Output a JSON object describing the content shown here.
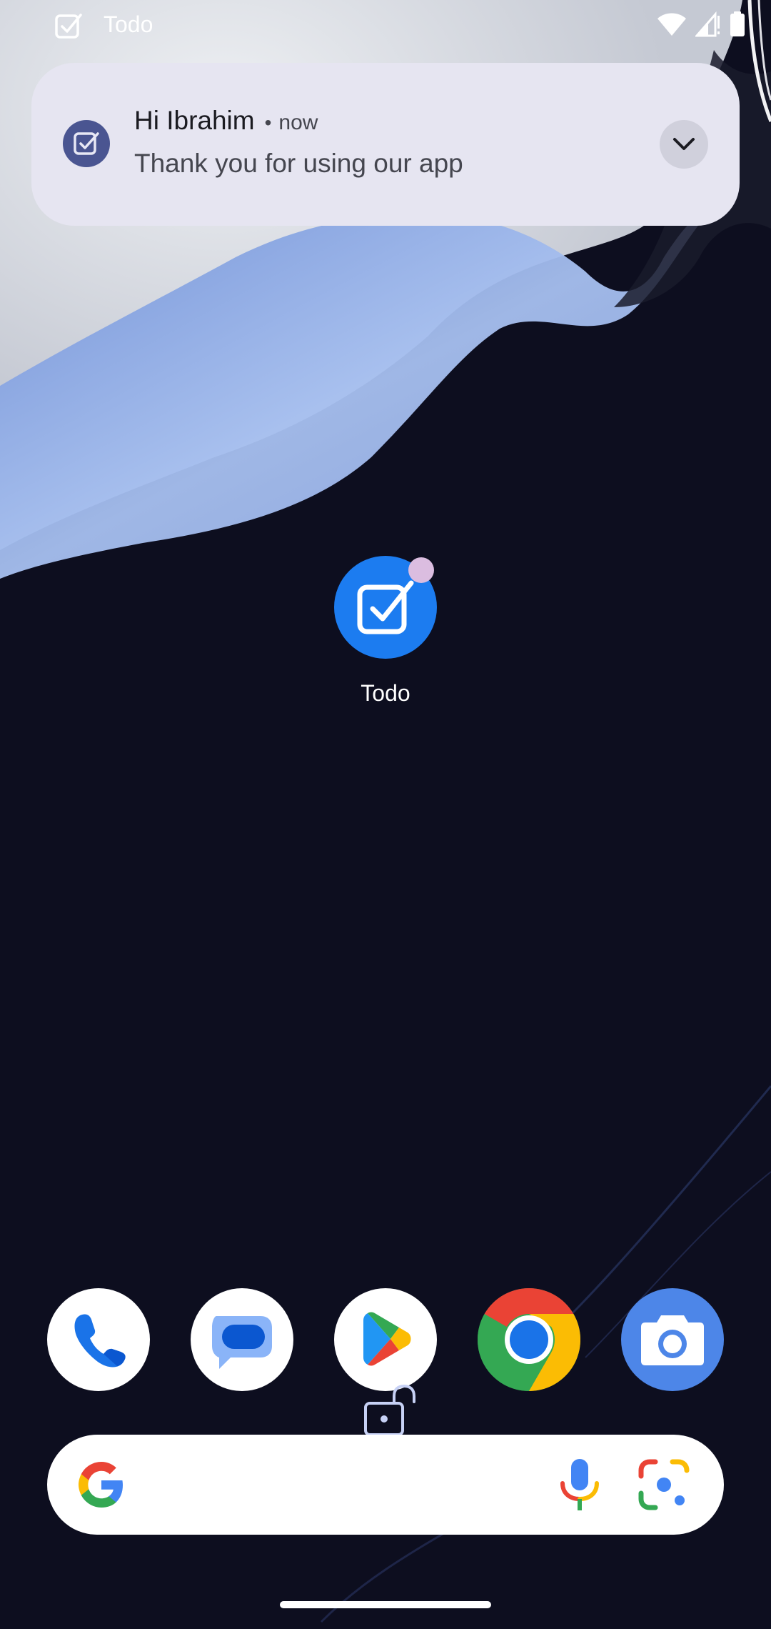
{
  "status_bar": {
    "app_name": "Todo",
    "app_icon": "checkbox-icon",
    "right_icons": [
      "wifi-icon",
      "cellular-signal-icon",
      "battery-icon"
    ]
  },
  "notification": {
    "icon": "checkbox-icon",
    "title": "Hi Ibrahim",
    "separator": "•",
    "time": "now",
    "body": "Thank you for using our app",
    "expand_icon": "chevron-down-icon"
  },
  "home": {
    "app": {
      "label": "Todo",
      "icon": "todo-app-icon",
      "has_badge": true
    }
  },
  "dock": {
    "apps": [
      {
        "name": "Phone",
        "icon": "phone-icon"
      },
      {
        "name": "Messages",
        "icon": "messages-icon"
      },
      {
        "name": "Play Store",
        "icon": "play-store-icon"
      },
      {
        "name": "Chrome",
        "icon": "chrome-icon"
      },
      {
        "name": "Camera",
        "icon": "camera-icon"
      }
    ]
  },
  "search_bar": {
    "left_icon": "google-g-icon",
    "right_icons": [
      "microphone-icon",
      "google-lens-icon"
    ]
  },
  "colors": {
    "notification_bg": "#e6e5f1",
    "notification_icon_bg": "#4a5591",
    "todo_icon_bg": "#1c7cf0",
    "badge": "#dbbde0",
    "wallpaper_dark": "#0d0e1f",
    "wallpaper_light": "#a8c0ee"
  }
}
